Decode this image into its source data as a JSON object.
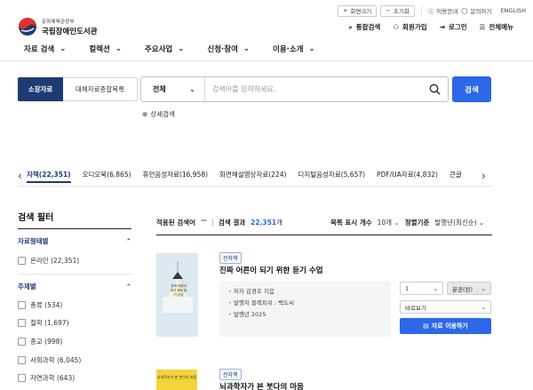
{
  "utility": {
    "zoom_in": "화면크기",
    "reset": "초기화",
    "guide": "이용안내",
    "inquiry": "문의하기",
    "english": "ENGLISH"
  },
  "logo": {
    "ministry": "문화체육관광부",
    "name": "국립장애인도서관"
  },
  "user_nav": {
    "search": "통합검색",
    "join": "회원가입",
    "login": "로그인",
    "menu": "전체메뉴"
  },
  "gnb": [
    "자료 검색",
    "컬렉션",
    "주요사업",
    "신청·참여",
    "이용·소개"
  ],
  "search": {
    "tab_active": "소장자료",
    "tab_other": "대체자료종합목록",
    "scope": "전체",
    "placeholder": "검색어를 입력하세요.",
    "button": "검색",
    "advanced": "상세검색"
  },
  "category_tabs": [
    "자책(22,351)",
    "오디오북(6,865)",
    "휴먼음성자료(16,958)",
    "화면해설영상자료(224)",
    "디지털음성자료(5,657)",
    "PDF/UA자료(4,832)",
    "큰글"
  ],
  "filter": {
    "title": "검색 필터",
    "groups": [
      {
        "title": "자료형태별",
        "items": [
          "온라인 (22,351)"
        ]
      },
      {
        "title": "주제별",
        "items": [
          "총류 (534)",
          "철학 (1,697)",
          "종교 (998)",
          "사회과학 (6,045)",
          "자연과학 (643)"
        ]
      }
    ]
  },
  "results": {
    "applied_label": "적용된 검색어",
    "applied_value": "\"\"",
    "count_label": "검색 결과",
    "count": "22,351",
    "count_unit": "개",
    "per_page_label": "목록 표시 개수",
    "per_page": "10개",
    "sort_label": "정렬기준",
    "sort": "발행년(최신순)",
    "items": [
      {
        "badge": "전자책",
        "title": "진짜 어른이 되기 위한 듣기 수업",
        "cover_text": "진짜 어른이 되기 위한 듣기 수업",
        "author": "저자  김경호 지음",
        "publisher": "발행처  블랙피쉬 : 백도씨",
        "year": "발행년  2025",
        "qty": "1",
        "cart": "분권(원)",
        "view": "바로보기",
        "use": "자료 이용하기"
      },
      {
        "badge": "전자책",
        "title": "뇌과학자가 본 붓다의 마음",
        "cover_text": "뇌과학자가 본 붓다의 마음"
      }
    ]
  }
}
